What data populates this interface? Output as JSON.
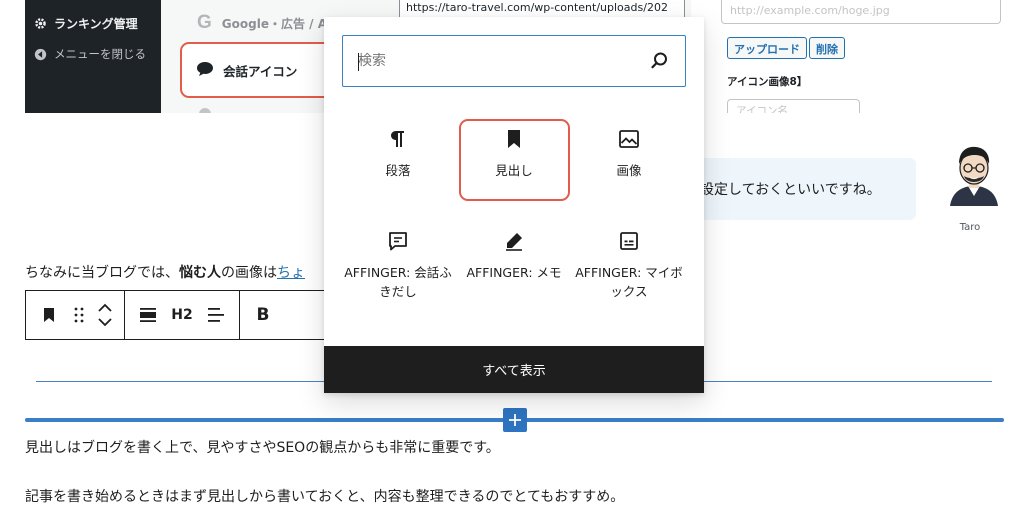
{
  "admin": {
    "ranking_label": "ランキング管理",
    "close_menu_label": "メニューを閉じる",
    "google_item_label": "Google・広告 / A",
    "kaiwa_item_label": "会話アイコン",
    "url_value": "https://taro-travel.com/wp-content/uploads/202",
    "url_placeholder": "http://example.com/hoge.jpg",
    "upload_label": "アップロード",
    "delete_label": "削除",
    "icon_image_label": "アイコン画像8】",
    "icon_name_placeholder": "アイコン名"
  },
  "editor": {
    "bubble_text": "設定しておくといいですね。",
    "avatar_name": "Taro",
    "para1": {
      "prefix": "ちなみに当ブログでは、",
      "bold": "悩む人",
      "middle": "の画像は",
      "link": "ちょ"
    },
    "heading_level": "H2",
    "bold_label": "B",
    "para2": "見出しはブログを書く上で、見やすさやSEOの観点からも非常に重要です。",
    "para3": "記事を書き始めるときはまず見出しから書いておくと、内容も整理できるのでとてもおすすめ。"
  },
  "inserter": {
    "search_placeholder": "検索",
    "blocks": [
      {
        "icon": "pilcrow-icon",
        "label": "段落"
      },
      {
        "icon": "bookmark-icon",
        "label": "見出し"
      },
      {
        "icon": "image-icon",
        "label": "画像"
      },
      {
        "icon": "speech-bubble-icon",
        "label": "AFFINGER: 会話ふきだし"
      },
      {
        "icon": "pen-icon",
        "label": "AFFINGER: メモ"
      },
      {
        "icon": "box-icon",
        "label": "AFFINGER: マイボックス"
      }
    ],
    "show_all_label": "すべて表示"
  },
  "colors": {
    "highlight": "#e25c4a",
    "accent_blue": "#3a7ec6",
    "admin_sidebar": "#1d2327",
    "bubble_bg": "#eef6fc"
  }
}
